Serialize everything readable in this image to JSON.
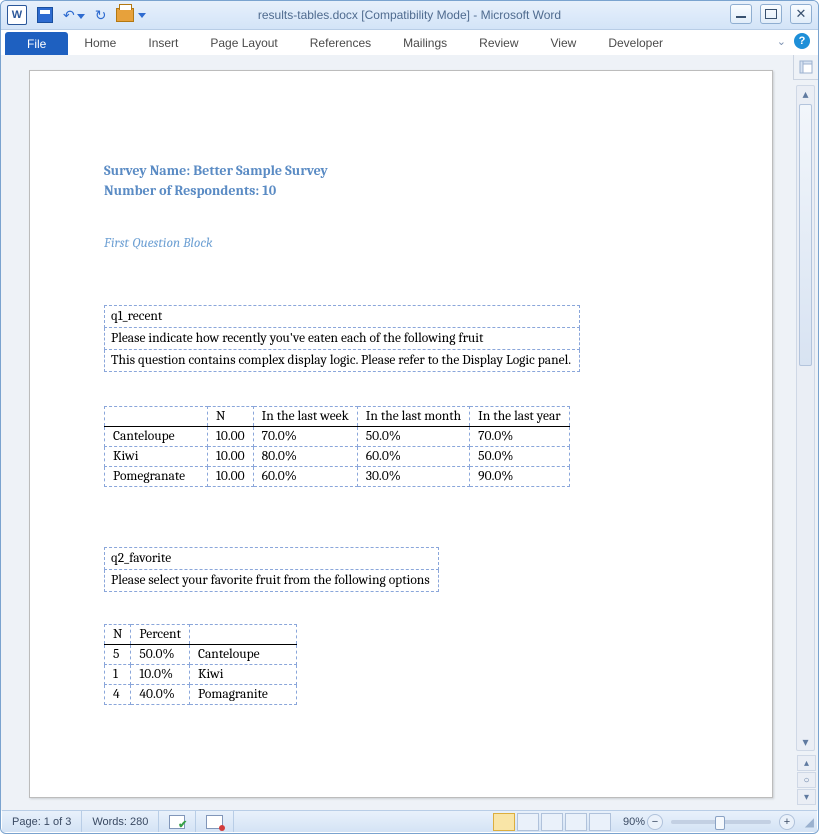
{
  "title": "results-tables.docx [Compatibility Mode] - Microsoft Word",
  "ribbon": {
    "file": "File",
    "tabs": [
      "Home",
      "Insert",
      "Page Layout",
      "References",
      "Mailings",
      "Review",
      "View",
      "Developer"
    ]
  },
  "doc": {
    "survey_label": "Survey Name: Better Sample Survey",
    "respondents_label": "Number of Respondents: 10",
    "block_title": "First Question Block",
    "q1": {
      "id": "q1_recent",
      "text": "Please indicate how recently you've eaten each of the following fruit",
      "note": "This question contains complex display logic. Please refer to the Display Logic panel.",
      "headers": [
        "",
        "N",
        "In the last week",
        "In the last month",
        "In the last year"
      ],
      "rows": [
        {
          "label": "Canteloupe",
          "n": "10.00",
          "week": "70.0%",
          "month": "50.0%",
          "year": "70.0%"
        },
        {
          "label": "Kiwi",
          "n": "10.00",
          "week": "80.0%",
          "month": "60.0%",
          "year": "50.0%"
        },
        {
          "label": "Pomegranate",
          "n": "10.00",
          "week": "60.0%",
          "month": "30.0%",
          "year": "90.0%"
        }
      ]
    },
    "q2": {
      "id": "q2_favorite",
      "text": "Please select your favorite fruit from the following options",
      "headers": [
        "N",
        "Percent",
        ""
      ],
      "rows": [
        {
          "n": "5",
          "pct": "50.0%",
          "label": "Canteloupe"
        },
        {
          "n": "1",
          "pct": "10.0%",
          "label": "Kiwi"
        },
        {
          "n": "4",
          "pct": "40.0%",
          "label": "Pomagranite"
        }
      ]
    }
  },
  "status": {
    "page": "Page: 1 of 3",
    "words": "Words: 280",
    "zoom": "90%"
  }
}
